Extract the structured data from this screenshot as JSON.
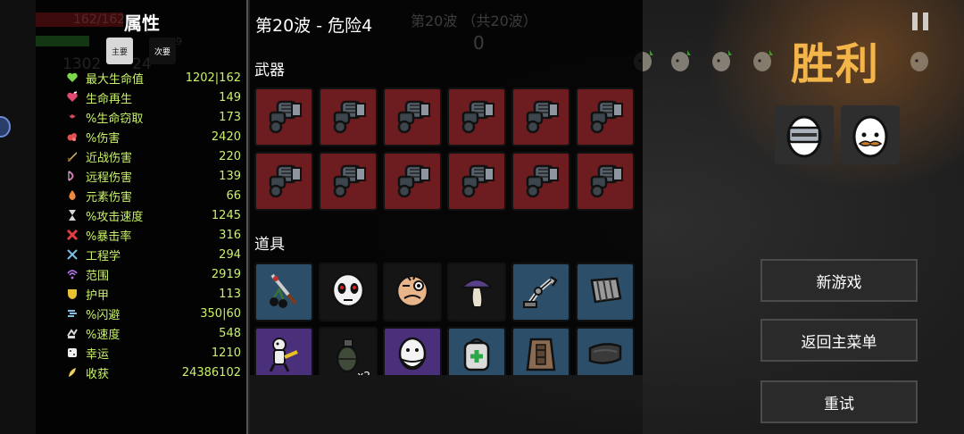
{
  "stats": {
    "title": "属性",
    "tab_primary": "主要",
    "tab_secondary": "次要",
    "faint_hp": "162/162",
    "faint_xp": "1302",
    "faint_mid": "69",
    "faint_num": "24",
    "items": [
      {
        "icon": "heart-icon",
        "label": "最大生命值",
        "value": "1202|162",
        "color": "#7ad84a"
      },
      {
        "icon": "regen-heart-icon",
        "label": "生命再生",
        "value": "149",
        "color": "#e04a70"
      },
      {
        "icon": "lifesteal-icon",
        "label": "%生命窃取",
        "value": "173",
        "color": "#d44c5a"
      },
      {
        "icon": "damage-icon",
        "label": "%伤害",
        "value": "2420",
        "color": "#e05050"
      },
      {
        "icon": "sword-icon",
        "label": "近战伤害",
        "value": "220",
        "color": "#e6c060"
      },
      {
        "icon": "bow-icon",
        "label": "远程伤害",
        "value": "139",
        "color": "#d878b8"
      },
      {
        "icon": "flame-icon",
        "label": "元素伤害",
        "value": "66",
        "color": "#f08a40"
      },
      {
        "icon": "hourglass-icon",
        "label": "%攻击速度",
        "value": "1245",
        "color": "#d8d8d8"
      },
      {
        "icon": "crit-icon",
        "label": "%暴击率",
        "value": "316",
        "color": "#e04040"
      },
      {
        "icon": "wrench-icon",
        "label": "工程学",
        "value": "294",
        "color": "#7ac0e8"
      },
      {
        "icon": "range-icon",
        "label": "范围",
        "value": "2919",
        "color": "#b070e0"
      },
      {
        "icon": "shield-icon",
        "label": "护甲",
        "value": "113",
        "color": "#e8c030"
      },
      {
        "icon": "dodge-icon",
        "label": "%闪避",
        "value": "350|60",
        "color": "#80c0e0"
      },
      {
        "icon": "speed-icon",
        "label": "%速度",
        "value": "548",
        "color": "#d8d8d8"
      },
      {
        "icon": "dice-icon",
        "label": "幸运",
        "value": "1210",
        "color": "#f0f0f0"
      },
      {
        "icon": "harvest-icon",
        "label": "收获",
        "value": "24386102",
        "color": "#f0d060"
      }
    ]
  },
  "main": {
    "wave_title": "第20波 - 危险4",
    "wave_counter": "第20波 （共20波）",
    "wave_zero": "0",
    "weapons_label": "武器",
    "items_label": "道具",
    "weapons": [
      {
        "icon": "minigun-icon",
        "tier": "red"
      },
      {
        "icon": "minigun-icon",
        "tier": "red"
      },
      {
        "icon": "minigun-icon",
        "tier": "red"
      },
      {
        "icon": "minigun-icon",
        "tier": "red"
      },
      {
        "icon": "minigun-icon",
        "tier": "red"
      },
      {
        "icon": "minigun-icon",
        "tier": "red"
      },
      {
        "icon": "minigun-icon",
        "tier": "red"
      },
      {
        "icon": "minigun-icon",
        "tier": "red"
      },
      {
        "icon": "minigun-icon",
        "tier": "red"
      },
      {
        "icon": "minigun-icon",
        "tier": "red"
      },
      {
        "icon": "minigun-icon",
        "tier": "red"
      },
      {
        "icon": "minigun-icon",
        "tier": "red"
      }
    ],
    "items": [
      {
        "icon": "cherry-knife-icon",
        "tier": "blue",
        "count": ""
      },
      {
        "icon": "ghost-mask-icon",
        "tier": "black",
        "count": ""
      },
      {
        "icon": "weird-face-icon",
        "tier": "black",
        "count": ""
      },
      {
        "icon": "mushroom-icon",
        "tier": "black",
        "count": ""
      },
      {
        "icon": "robot-arm-icon",
        "tier": "blue",
        "count": ""
      },
      {
        "icon": "ribbed-cloth-icon",
        "tier": "blue",
        "count": ""
      },
      {
        "icon": "voodoo-doll-icon",
        "tier": "purple",
        "count": ""
      },
      {
        "icon": "grenade-icon",
        "tier": "black",
        "count": "x2"
      },
      {
        "icon": "bearded-egg-icon",
        "tier": "purple",
        "count": ""
      },
      {
        "icon": "medic-backpack-icon",
        "tier": "blue",
        "count": ""
      },
      {
        "icon": "leather-armor-icon",
        "tier": "blue",
        "count": ""
      },
      {
        "icon": "dark-scarf-icon",
        "tier": "blue",
        "count": ""
      }
    ]
  },
  "victory": {
    "title": "胜利",
    "characters": [
      "knight-egg-icon",
      "mustache-egg-icon"
    ]
  },
  "menu": {
    "new_game": "新游戏",
    "main_menu": "返回主菜单",
    "retry": "重试"
  },
  "colors": {
    "stat_text": "#c9f26a",
    "victory": "#f3b54a",
    "weapon_tier": "#6d1c1f",
    "item_blue": "#2d4e68",
    "item_purple": "#4a2f7a"
  }
}
